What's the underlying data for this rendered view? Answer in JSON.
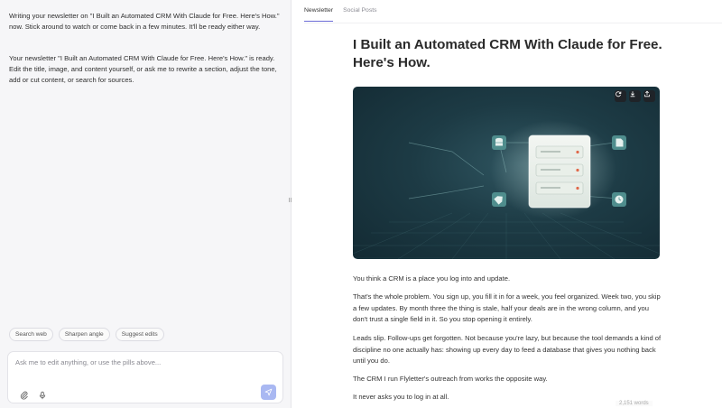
{
  "chat": {
    "message_1": "Writing your newsletter on \"I Built an Automated CRM With Claude for Free. Here's How.\" now. Stick around to watch or come back in a few minutes. It'll be ready either way.",
    "message_2": "Your newsletter \"I Built an Automated CRM With Claude for Free. Here's How.\" is ready. Edit the title, image, and content yourself, or ask me to rewrite a section, adjust the tone, add or cut content, or search for sources.",
    "pills": [
      "Search web",
      "Sharpen angle",
      "Suggest edits"
    ],
    "composer_placeholder": "Ask me to edit anything, or use the pills above..."
  },
  "tabs": [
    {
      "label": "Newsletter",
      "active": true
    },
    {
      "label": "Social Posts",
      "active": false
    }
  ],
  "article": {
    "title": "I Built an Automated CRM With Claude for Free. Here's How.",
    "paragraphs": [
      "You think a CRM is a place you log into and update.",
      "That's the whole problem. You sign up, you fill it in for a week, you feel organized. Week two, you skip a few updates. By month three the thing is stale, half your deals are in the wrong column, and you don't trust a single field in it. So you stop opening it entirely.",
      "Leads slip. Follow-ups get forgotten. Not because you're lazy, but because the tool demands a kind of discipline no one actually has: showing up every day to feed a database that gives you nothing back until you do.",
      "The CRM I run Flyletter's outreach from works the opposite way.",
      "It never asks you to log in at all."
    ],
    "word_count": "2,151 words"
  },
  "hero_image": {
    "icons": [
      "refresh-icon",
      "download-icon",
      "share-icon"
    ],
    "illustration": [
      "database-icon",
      "document-icon",
      "tag-icon",
      "clock-icon",
      "server-stack"
    ]
  },
  "colors": {
    "accent": "#6b6bd6",
    "send_button": "#a9b8f2",
    "hero_bg": "#1d3b45",
    "server_dot": "#e0684a"
  }
}
